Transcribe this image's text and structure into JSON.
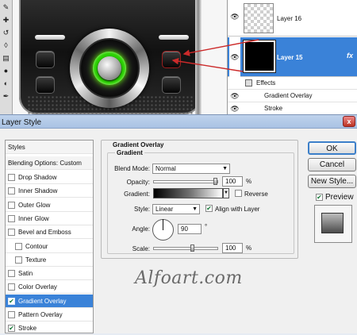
{
  "layers": {
    "items": [
      {
        "name": "Layer 16",
        "selected": false
      },
      {
        "name": "Layer 15",
        "selected": true,
        "fx": "fx"
      }
    ],
    "effects": {
      "label": "Effects",
      "items": [
        "Gradient Overlay",
        "Stroke"
      ]
    }
  },
  "dialog": {
    "title": "Layer Style",
    "close": "x",
    "styles_header": "Styles",
    "blending_options": "Blending Options: Custom",
    "style_items": [
      {
        "label": "Drop Shadow",
        "checked": false
      },
      {
        "label": "Inner Shadow",
        "checked": false
      },
      {
        "label": "Outer Glow",
        "checked": false
      },
      {
        "label": "Inner Glow",
        "checked": false
      },
      {
        "label": "Bevel and Emboss",
        "checked": false
      },
      {
        "label": "Contour",
        "checked": false
      },
      {
        "label": "Texture",
        "checked": false
      },
      {
        "label": "Satin",
        "checked": false
      },
      {
        "label": "Color Overlay",
        "checked": false
      },
      {
        "label": "Gradient Overlay",
        "checked": true,
        "selected": true
      },
      {
        "label": "Pattern Overlay",
        "checked": false
      },
      {
        "label": "Stroke",
        "checked": true
      }
    ],
    "panel": {
      "section_title": "Gradient Overlay",
      "group_title": "Gradient",
      "blend_mode_label": "Blend Mode:",
      "blend_mode_value": "Normal",
      "opacity_label": "Opacity:",
      "opacity_value": "100",
      "opacity_unit": "%",
      "gradient_label": "Gradient:",
      "reverse_label": "Reverse",
      "reverse_checked": false,
      "style_label": "Style:",
      "style_value": "Linear",
      "align_label": "Align with Layer",
      "align_checked": true,
      "angle_label": "Angle:",
      "angle_value": "90",
      "angle_unit": "°",
      "scale_label": "Scale:",
      "scale_value": "100",
      "scale_unit": "%"
    },
    "buttons": {
      "ok": "OK",
      "cancel": "Cancel",
      "new_style": "New Style..."
    },
    "preview": {
      "label": "Preview",
      "checked": true
    }
  },
  "watermark": "Alfoart.com",
  "colors": {
    "selection": "#3a82d8",
    "glow": "#2ad000",
    "arrow": "#cc2a2a"
  }
}
